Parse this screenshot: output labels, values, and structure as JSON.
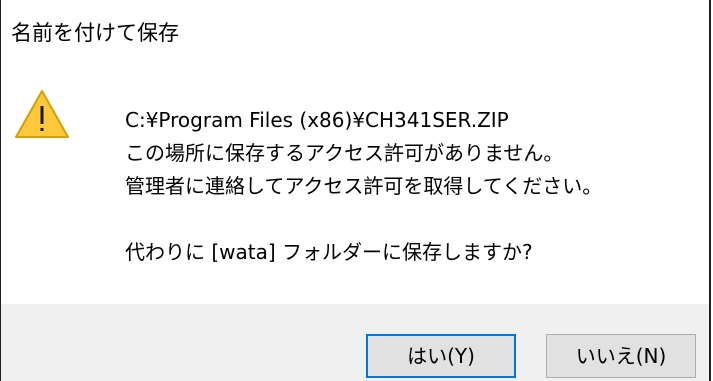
{
  "dialog": {
    "title": "名前を付けて保存",
    "icon": "warning-icon",
    "message": {
      "path": "C:¥Program Files (x86)¥CH341SER.ZIP",
      "line1": "この場所に保存するアクセス許可がありません。",
      "line2": "管理者に連絡してアクセス許可を取得してください。",
      "question": "代わりに [wata] フォルダーに保存しますか?"
    },
    "buttons": {
      "yes_label": "はい(Y)",
      "no_label": "いいえ(N)"
    }
  },
  "colors": {
    "warning_fill": "#ffc83d",
    "warning_stroke": "#d69e00",
    "default_button_border": "#0078d7",
    "footer_background": "#f0f0f0"
  }
}
